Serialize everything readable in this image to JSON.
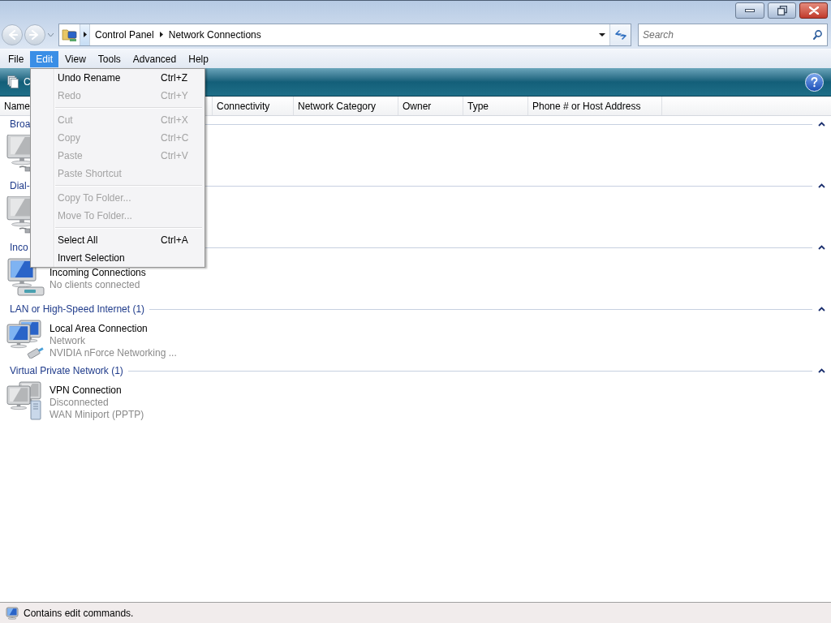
{
  "nav_buttons": [
    {
      "kind": "back",
      "disabled": true
    },
    {
      "kind": "forward",
      "disabled": true
    }
  ],
  "address_bar": {
    "crumbs": [
      "Control Panel",
      "Network Connections"
    ]
  },
  "search": {
    "placeholder": "Search"
  },
  "menu_bar": [
    {
      "label": "File",
      "selected": false
    },
    {
      "label": "Edit",
      "selected": true
    },
    {
      "label": "View",
      "selected": false
    },
    {
      "label": "Tools",
      "selected": false
    },
    {
      "label": "Advanced",
      "selected": false
    },
    {
      "label": "Help",
      "selected": false
    }
  ],
  "edit_menu": [
    {
      "kind": "item",
      "label": "Undo Rename",
      "shortcut": "Ctrl+Z",
      "disabled": false
    },
    {
      "kind": "item",
      "label": "Redo",
      "shortcut": "Ctrl+Y",
      "disabled": true
    },
    {
      "kind": "separator"
    },
    {
      "kind": "item",
      "label": "Cut",
      "shortcut": "Ctrl+X",
      "disabled": true
    },
    {
      "kind": "item",
      "label": "Copy",
      "shortcut": "Ctrl+C",
      "disabled": true
    },
    {
      "kind": "item",
      "label": "Paste",
      "shortcut": "Ctrl+V",
      "disabled": true
    },
    {
      "kind": "item",
      "label": "Paste Shortcut",
      "disabled": true
    },
    {
      "kind": "separator"
    },
    {
      "kind": "item",
      "label": "Copy To Folder...",
      "disabled": true
    },
    {
      "kind": "item",
      "label": "Move To Folder...",
      "disabled": true
    },
    {
      "kind": "separator"
    },
    {
      "kind": "item",
      "label": "Select All",
      "shortcut": "Ctrl+A",
      "disabled": false
    },
    {
      "kind": "item",
      "label": "Invert Selection",
      "disabled": false
    }
  ],
  "toolbar": {
    "items": [
      {
        "label": "C"
      }
    ]
  },
  "columns": [
    {
      "label": "Name"
    },
    {
      "label": "Connectivity"
    },
    {
      "label": "Network Category"
    },
    {
      "label": "Owner"
    },
    {
      "label": "Type"
    },
    {
      "label": "Phone # or Host Address"
    }
  ],
  "groups": [
    {
      "label": "Broa",
      "expanded": true,
      "items": [
        {
          "kind": "modem"
        }
      ]
    },
    {
      "label": "Dial-",
      "expanded": true,
      "items": [
        {
          "kind": "modem"
        }
      ]
    },
    {
      "label": "Inco",
      "expanded": true,
      "items": [
        {
          "kind": "incoming",
          "name": "Incoming Connections",
          "details": [
            "No clients connected"
          ]
        }
      ]
    },
    {
      "label": "LAN or High-Speed Internet (1)",
      "expanded": true,
      "items": [
        {
          "kind": "lan",
          "name": "Local Area Connection",
          "details": [
            "Network",
            "NVIDIA nForce Networking ..."
          ]
        }
      ]
    },
    {
      "label": "Virtual Private Network (1)",
      "expanded": true,
      "items": [
        {
          "kind": "vpn",
          "name": "VPN Connection",
          "details": [
            "Disconnected",
            "WAN Miniport (PPTP)"
          ]
        }
      ]
    }
  ],
  "status_bar": {
    "text": "Contains edit commands."
  }
}
